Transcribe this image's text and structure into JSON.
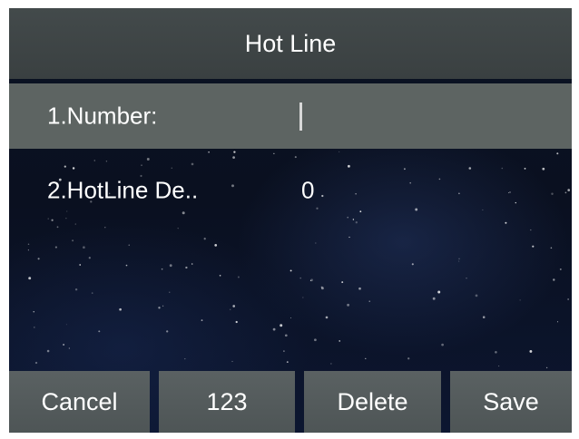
{
  "header": {
    "title": "Hot Line"
  },
  "fields": [
    {
      "label": "1.Number:",
      "value": "",
      "selected": true
    },
    {
      "label": "2.HotLine De..",
      "value": "0",
      "selected": false
    }
  ],
  "softkeys": [
    {
      "label": "Cancel"
    },
    {
      "label": "123"
    },
    {
      "label": "Delete"
    },
    {
      "label": "Save"
    }
  ],
  "colors": {
    "title_bar": "#3d4344",
    "selected_row": "#5d6462",
    "softkey": "#555c5d",
    "background": "#0a1020",
    "text": "#ffffff"
  }
}
